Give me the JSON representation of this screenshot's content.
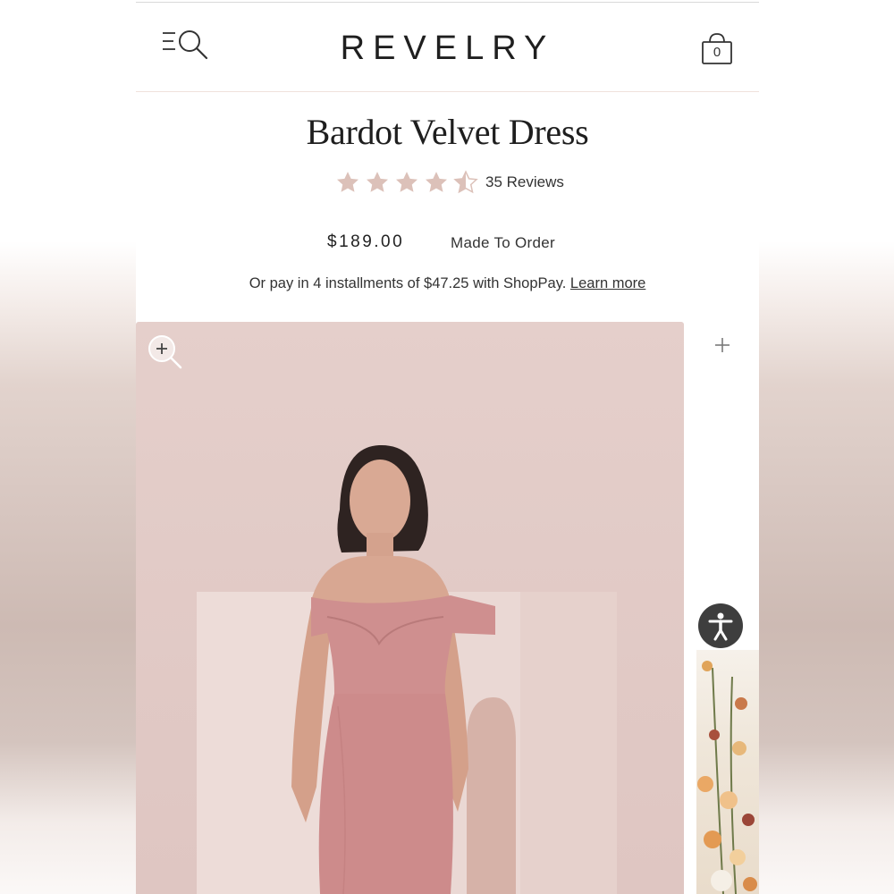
{
  "header": {
    "brand": "REVELRY",
    "cart_count": "0",
    "menu_icon": "menu-search-icon",
    "cart_icon": "shopping-bag-icon"
  },
  "product": {
    "title": "Bardot Velvet Dress",
    "rating": 4.5,
    "rating_max": 5,
    "reviews_label": "35 Reviews",
    "price": "$189.00",
    "availability": "Made To Order",
    "installments_text": "Or pay in 4 installments of $47.25 with ShopPay.",
    "learn_more": "Learn more"
  },
  "gallery": {
    "zoom_icon": "zoom-in-icon",
    "thumb_plus_icon": "plus-icon"
  },
  "accessibility": {
    "icon": "accessibility-icon"
  },
  "colors": {
    "star": "#dcc1b9",
    "image_bg": "#e4cdc9",
    "dress": "#cf8f8f",
    "accessibility_button": "#3e3e3e"
  }
}
